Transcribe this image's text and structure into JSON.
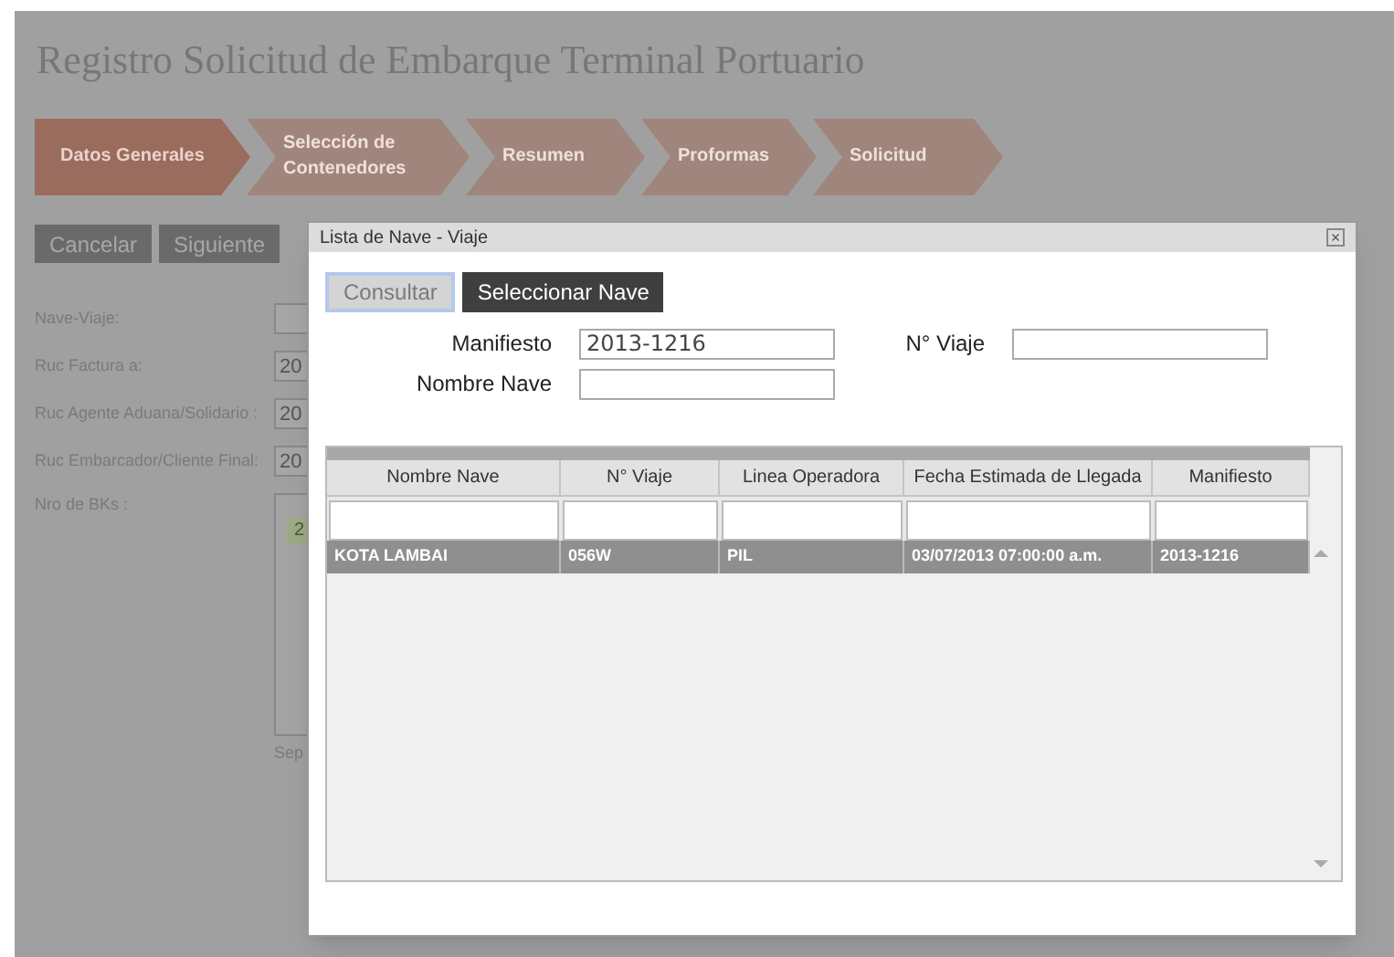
{
  "page": {
    "title": "Registro Solicitud de Embarque Terminal Portuario",
    "steps": [
      {
        "label": "Datos Generales",
        "selected": true
      },
      {
        "label": "Selección de Contenedores",
        "selected": false
      },
      {
        "label": "Resumen",
        "selected": false
      },
      {
        "label": "Proformas",
        "selected": false
      },
      {
        "label": "Solicitud",
        "selected": false
      }
    ],
    "buttons": [
      "Cancelar",
      "Siguiente"
    ],
    "fields": [
      {
        "label": "Nave-Viaje:"
      },
      {
        "label": "Ruc Factura a:",
        "value": "20"
      },
      {
        "label": "Ruc Agente Aduana/Solidario :",
        "value": "20"
      },
      {
        "label": "Ruc Embarcador/Cliente Final:",
        "value": "20"
      }
    ],
    "bks": {
      "label": "Nro de BKs :",
      "chip": "2",
      "note": "Sep"
    }
  },
  "dialog": {
    "title": "Lista de Nave - Viaje",
    "close": "×",
    "buttons": [
      {
        "label": "Consultar",
        "disabled": true
      },
      {
        "label": "Seleccionar Nave",
        "disabled": false
      }
    ],
    "fields": [
      {
        "label": "Manifiesto",
        "value": "2013-1216"
      },
      {
        "label": "N° Viaje"
      },
      {
        "label": "Nombre Nave"
      }
    ],
    "table": {
      "columns": [
        "Nombre Nave",
        "N° Viaje",
        "Linea Operadora",
        "Fecha Estimada de Llegada",
        "Manifiesto"
      ],
      "rows": [
        {
          "cells": [
            "KOTA LAMBAI",
            "056W",
            "PIL",
            "03/07/2013 07:00:00 a.m.",
            "2013-1216"
          ],
          "selected": true
        }
      ]
    }
  }
}
